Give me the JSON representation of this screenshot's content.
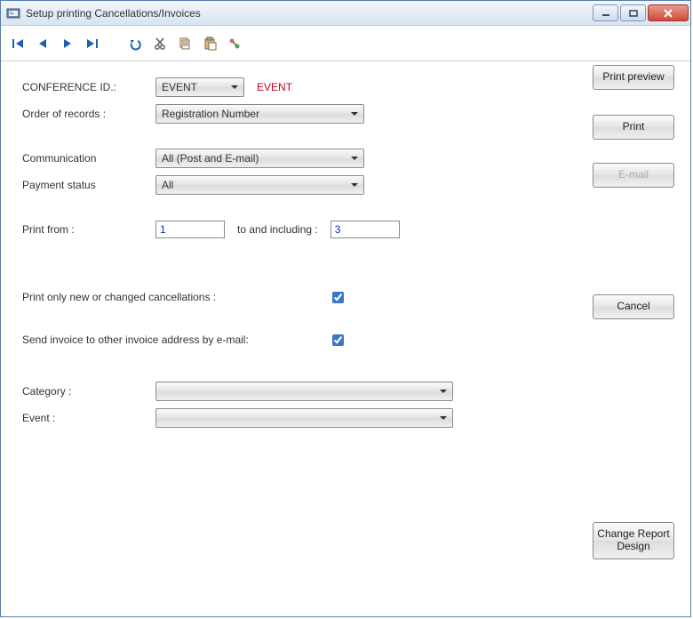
{
  "window": {
    "title": "Setup printing Cancellations/Invoices"
  },
  "labels": {
    "conference_id": "CONFERENCE ID.:",
    "order_of_records": "Order of records :",
    "communication": "Communication",
    "payment_status": "Payment status",
    "print_from": "Print from :",
    "to_including": "to and including :",
    "print_new_changed": "Print only new or changed cancellations :",
    "send_invoice_email": "Send invoice to other invoice address by e-mail:",
    "category": "Category :",
    "event": "Event :"
  },
  "values": {
    "conference_id": "EVENT",
    "conference_badge": "EVENT",
    "order_of_records": "Registration Number",
    "communication": "All (Post and E-mail)",
    "payment_status": "All",
    "print_from": "1",
    "print_to": "3",
    "cb_new_changed": true,
    "cb_send_invoice": true,
    "category": "",
    "event": ""
  },
  "buttons": {
    "print_preview": "Print preview",
    "print": "Print",
    "email": "E-mail",
    "cancel": "Cancel",
    "change_report": "Change Report Design"
  }
}
